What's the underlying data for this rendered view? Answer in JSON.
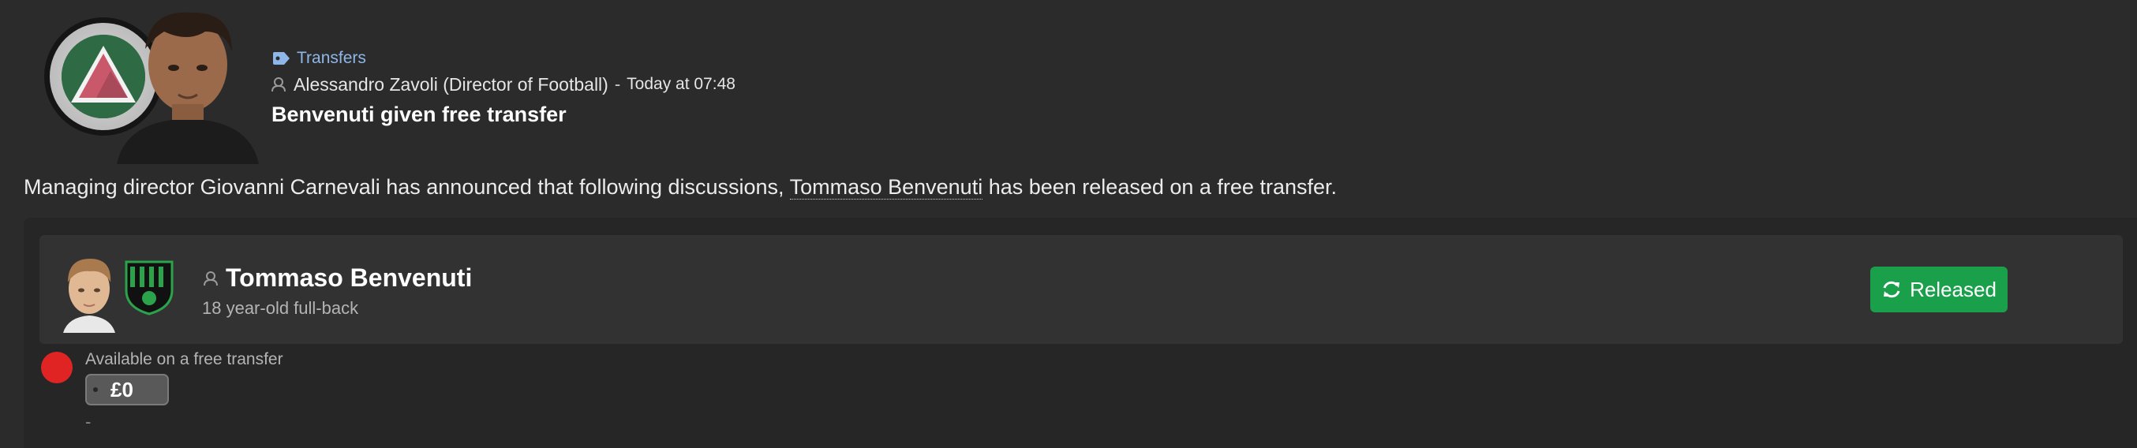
{
  "news": {
    "category": "Transfers",
    "author": "Alessandro Zavoli (Director of Football)",
    "separator": "-",
    "timestamp": "Today at 07:48",
    "headline": "Benvenuti given free transfer",
    "body_before": "Managing director Giovanni Carnevali has announced that following discussions, ",
    "body_link": "Tommaso Benvenuti",
    "body_after": " has been released on a free transfer."
  },
  "player": {
    "name": "Tommaso Benvenuti",
    "description": "18 year-old full-back",
    "status_button": "Released",
    "availability": "Available on a free transfer",
    "fee": "£0",
    "extra": "-"
  },
  "colors": {
    "accent_link": "#8fb6e8",
    "released_green": "#1aa04b",
    "status_red": "#e02424",
    "background": "#2b2b2b"
  },
  "icons": {
    "category": "tag-icon",
    "author": "person-icon",
    "player": "person-icon",
    "button": "refresh-icon"
  }
}
